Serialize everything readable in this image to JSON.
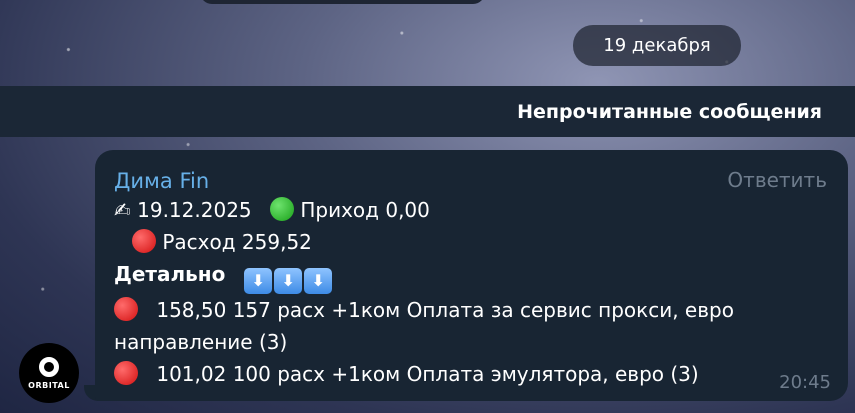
{
  "date_separator": "19 декабря",
  "unread_banner": "Непрочитанные сообщения",
  "avatar": {
    "logo_text": "ORBITAL"
  },
  "message": {
    "sender": "Дима Fin",
    "reply_label": "Ответить",
    "time": "20:45",
    "icons": {
      "writing": "writing-hand-icon",
      "income": "green-circle-icon",
      "expense": "red-circle-icon",
      "down": "down-arrow-icon"
    },
    "lines": {
      "date_line_date": "19.12.2025",
      "income_label": "Приход  0,00",
      "expense_label": "Расход  259,52",
      "details_label": "Детально",
      "item1_main": "158,50  157 расх +1ком Оплата за сервис прокси, евро",
      "item1_cont": "направление (3)",
      "item2_main": "101,02  100 расх +1ком Оплата эмулятора, евро (3)"
    },
    "colors": {
      "sender": "#67b0e8",
      "bubble": "#182533",
      "meta": "#6e7c8c"
    }
  }
}
